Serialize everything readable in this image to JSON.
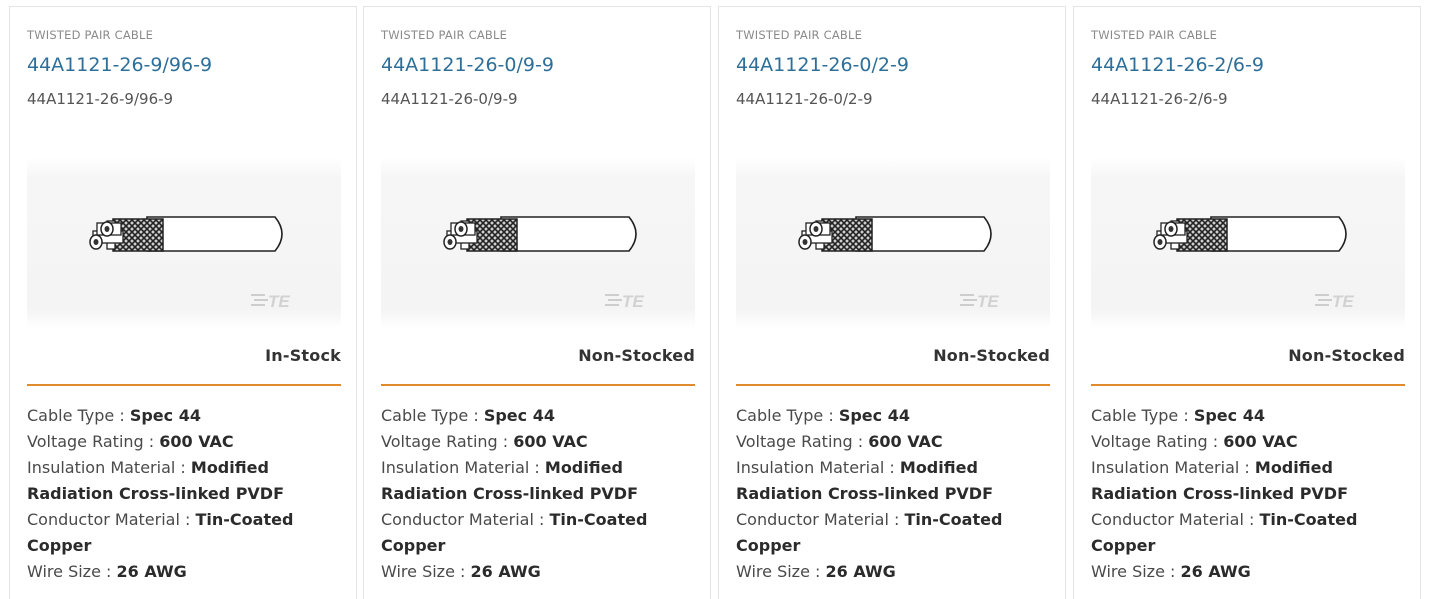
{
  "products": [
    {
      "category": "TWISTED PAIR CABLE",
      "title": "44A1121-26-9/96-9",
      "part_number": "44A1121-26-9/96-9",
      "brand_mark": "TE",
      "stock": "In-Stock",
      "specs": [
        {
          "label": "Cable Type : ",
          "value": "Spec 44"
        },
        {
          "label": "Voltage Rating : ",
          "value": "600 VAC"
        },
        {
          "label": "Insulation Material : ",
          "value": "Modified Radiation Cross-linked PVDF"
        },
        {
          "label": "Conductor Material : ",
          "value": "Tin-Coated Copper"
        },
        {
          "label": "Wire Size : ",
          "value": "26 AWG"
        }
      ]
    },
    {
      "category": "TWISTED PAIR CABLE",
      "title": "44A1121-26-0/9-9",
      "part_number": "44A1121-26-0/9-9",
      "brand_mark": "TE",
      "stock": "Non-Stocked",
      "specs": [
        {
          "label": "Cable Type : ",
          "value": "Spec 44"
        },
        {
          "label": "Voltage Rating : ",
          "value": "600 VAC"
        },
        {
          "label": "Insulation Material : ",
          "value": "Modified Radiation Cross-linked PVDF"
        },
        {
          "label": "Conductor Material : ",
          "value": "Tin-Coated Copper"
        },
        {
          "label": "Wire Size : ",
          "value": "26 AWG"
        }
      ]
    },
    {
      "category": "TWISTED PAIR CABLE",
      "title": "44A1121-26-0/2-9",
      "part_number": "44A1121-26-0/2-9",
      "brand_mark": "TE",
      "stock": "Non-Stocked",
      "specs": [
        {
          "label": "Cable Type : ",
          "value": "Spec 44"
        },
        {
          "label": "Voltage Rating : ",
          "value": "600 VAC"
        },
        {
          "label": "Insulation Material : ",
          "value": "Modified Radiation Cross-linked PVDF"
        },
        {
          "label": "Conductor Material : ",
          "value": "Tin-Coated Copper"
        },
        {
          "label": "Wire Size : ",
          "value": "26 AWG"
        }
      ]
    },
    {
      "category": "TWISTED PAIR CABLE",
      "title": "44A1121-26-2/6-9",
      "part_number": "44A1121-26-2/6-9",
      "brand_mark": "TE",
      "stock": "Non-Stocked",
      "specs": [
        {
          "label": "Cable Type : ",
          "value": "Spec 44"
        },
        {
          "label": "Voltage Rating : ",
          "value": "600 VAC"
        },
        {
          "label": "Insulation Material : ",
          "value": "Modified Radiation Cross-linked PVDF"
        },
        {
          "label": "Conductor Material : ",
          "value": "Tin-Coated Copper"
        },
        {
          "label": "Wire Size : ",
          "value": "26 AWG"
        }
      ]
    }
  ],
  "colors": {
    "link": "#2e6f99",
    "divider": "#e08a2c",
    "border": "#e4e4e4"
  }
}
